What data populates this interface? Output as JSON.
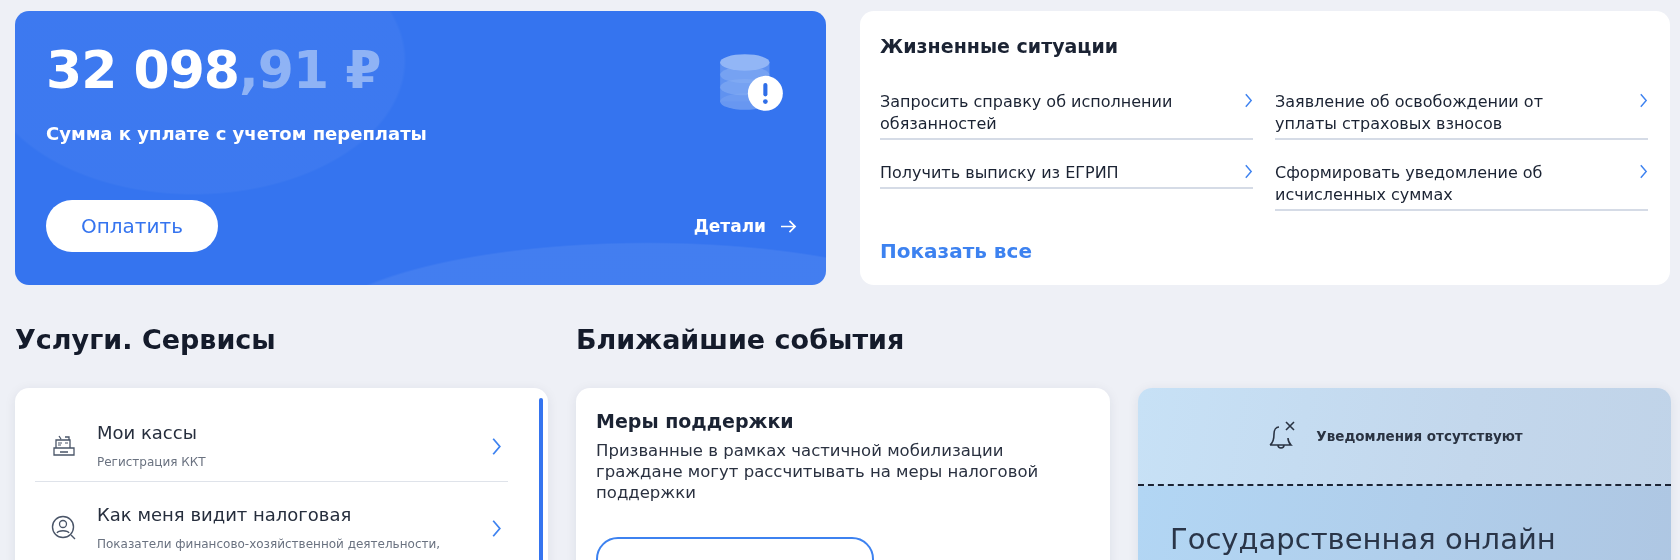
{
  "balance": {
    "amount_whole": "32 098",
    "amount_fraction": ",91 ₽",
    "caption": "Сумма к уплате с учетом переплаты",
    "pay_button": "Оплатить",
    "details_link": "Детали"
  },
  "life_situations": {
    "title": "Жизненные ситуации",
    "items": [
      {
        "label": "Запросить справку об исполнении обязанностей"
      },
      {
        "label": "Заявление об освобождении от уплаты страховых взносов"
      },
      {
        "label": "Получить выписку из ЕГРИП"
      },
      {
        "label": "Сформировать уведомление об исчисленных суммах"
      }
    ],
    "show_all": "Показать все"
  },
  "services": {
    "title": "Услуги. Сервисы",
    "items": [
      {
        "kind": "register",
        "title": "Мои кассы",
        "subtitle": "Регистрация ККТ"
      },
      {
        "kind": "profile",
        "title": "Как меня видит налоговая",
        "subtitle": "Показатели финансово-хозяйственной деятельности,"
      }
    ]
  },
  "events": {
    "title": "Ближайшие события",
    "cards": [
      {
        "title": "Меры поддержки",
        "text": "Призванные в рамках частичной мобилизации граждане могут рассчитывать на меры налоговой поддержки"
      }
    ]
  },
  "notifications": {
    "message": "Уведомления отсутствуют",
    "promo_title": "Государственная онлайн"
  }
}
